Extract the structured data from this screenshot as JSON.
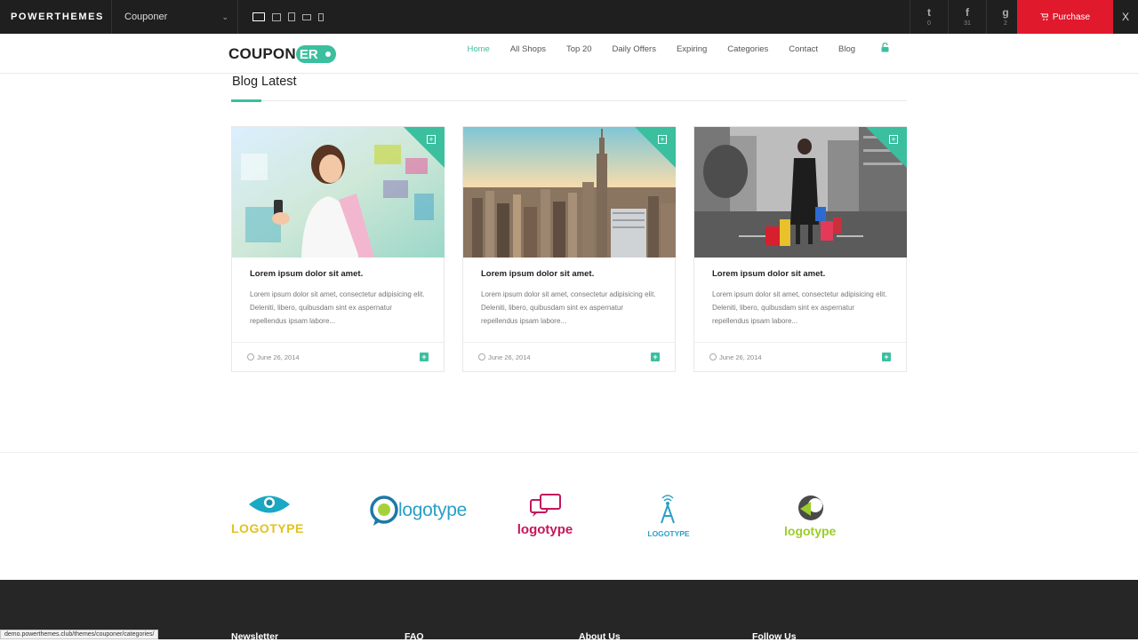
{
  "demobar": {
    "brand": "POWERTHEMES",
    "theme_selected": "Couponer",
    "social": [
      {
        "icon": "twitter-icon",
        "glyph": "t",
        "count": "0"
      },
      {
        "icon": "facebook-icon",
        "glyph": "f",
        "count": "31"
      },
      {
        "icon": "google-plus-icon",
        "glyph": "g",
        "count": "2"
      }
    ],
    "purchase_label": "Purchase",
    "close_label": "X"
  },
  "header": {
    "logo_word": "COUPON",
    "logo_badge": "ER",
    "nav": [
      "Home",
      "All Shops",
      "Top 20",
      "Daily Offers",
      "Expiring",
      "Categories",
      "Contact",
      "Blog"
    ],
    "active_nav": "Home"
  },
  "blog": {
    "title": "Blog Latest",
    "posts": [
      {
        "title": "Lorem ipsum dolor sit amet.",
        "excerpt": "Lorem ipsum dolor sit amet, consectetur adipisicing elit. Deleniti, libero, quibusdam sint ex aspernatur repellendus ipsam labore...",
        "date": "June 26, 2014"
      },
      {
        "title": "Lorem ipsum dolor sit amet.",
        "excerpt": "Lorem ipsum dolor sit amet, consectetur adipisicing elit. Deleniti, libero, quibusdam sint ex aspernatur repellendus ipsam labore...",
        "date": "June 26, 2014"
      },
      {
        "title": "Lorem ipsum dolor sit amet.",
        "excerpt": "Lorem ipsum dolor sit amet, consectetur adipisicing elit. Deleniti, libero, quibusdam sint ex aspernatur repellendus ipsam labore...",
        "date": "June 26, 2014"
      }
    ]
  },
  "partners": [
    {
      "text": "LOGOTYPE",
      "color": "#e4c21c"
    },
    {
      "text": "logotype",
      "color": "#2a9fc7"
    },
    {
      "text": "logotype",
      "color": "#c2185b"
    },
    {
      "text": "LOGOTYPE",
      "color": "#2a9fc7"
    },
    {
      "text": "logotype",
      "color": "#9ccc28"
    }
  ],
  "footer": {
    "headings": [
      "Newsletter",
      "FAQ",
      "About Us",
      "Follow Us"
    ]
  },
  "status_url": "demo.powerthemes.club/themes/couponer/categories/",
  "colors": {
    "accent": "#3bbf9f",
    "purchase": "#e0192d",
    "dark": "#1f1f1f"
  }
}
